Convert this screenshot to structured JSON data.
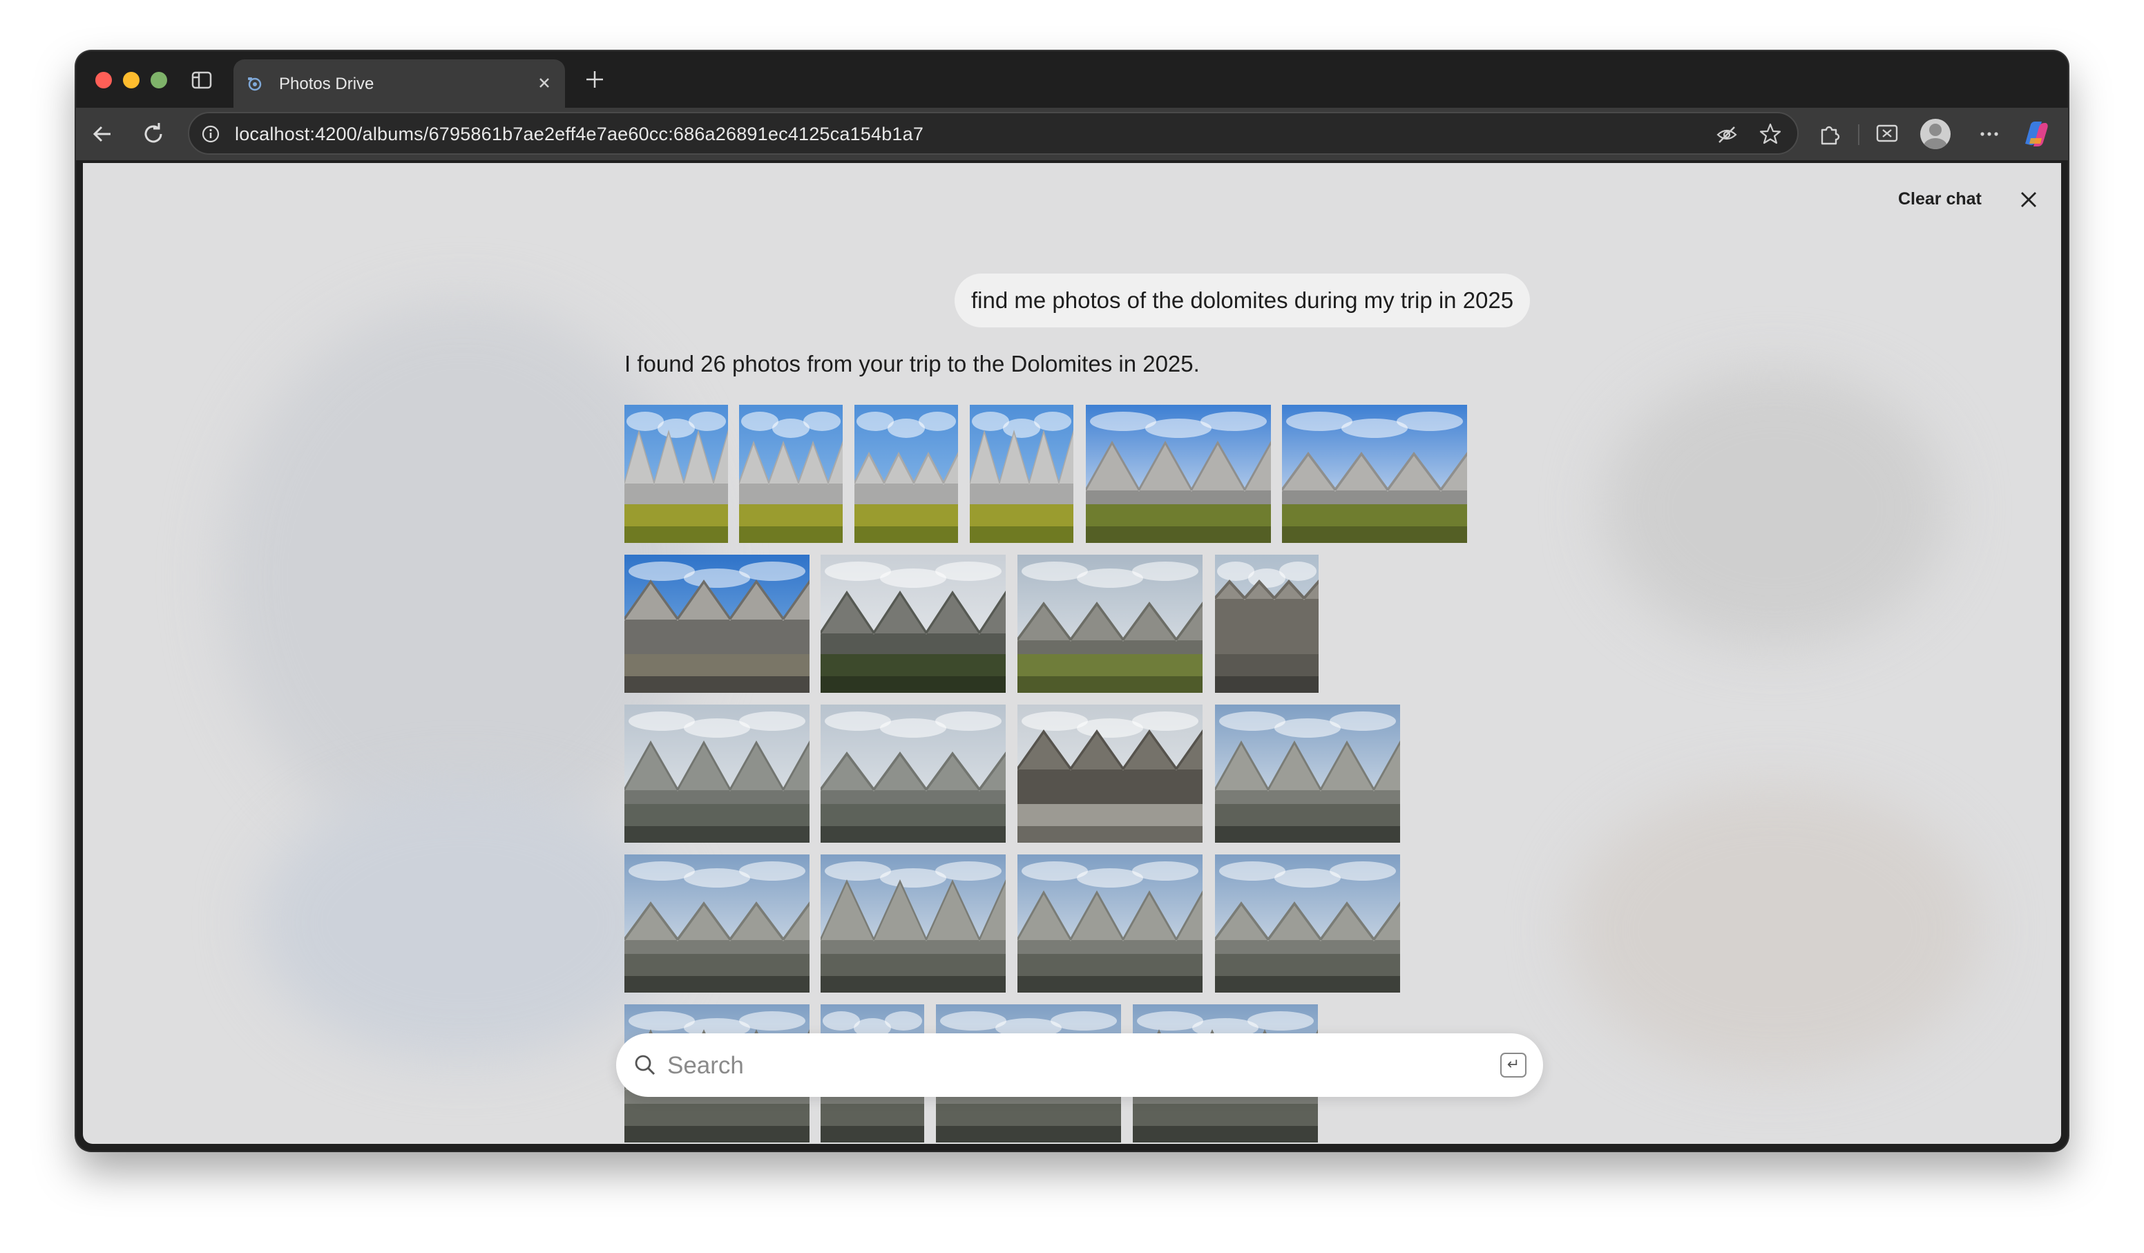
{
  "browser": {
    "tab_title": "Photos Drive",
    "url": "localhost:4200/albums/6795861b7ae2eff4e7ae60cc:686a26891ec4125ca154b1a7"
  },
  "chat": {
    "clear_label": "Clear chat",
    "user_message": "find me photos of the dolomites during my trip in 2025",
    "assistant_reply": "I found 26 photos from your trip to the Dolomites in 2025."
  },
  "search": {
    "placeholder": "Search",
    "enter_icon": "↵"
  },
  "photos": [
    {
      "scene": "meadow-peaks"
    },
    {
      "scene": "meadow-peaks"
    },
    {
      "scene": "meadow-peaks"
    },
    {
      "scene": "meadow-peaks"
    },
    {
      "scene": "village-peaks"
    },
    {
      "scene": "village-peaks"
    },
    {
      "scene": "sharp-peaks"
    },
    {
      "scene": "cloudy-peaks"
    },
    {
      "scene": "cloudy-valley"
    },
    {
      "scene": "tower"
    },
    {
      "scene": "grey-ridge"
    },
    {
      "scene": "grey-ridge"
    },
    {
      "scene": "three-peaks"
    },
    {
      "scene": "cloudy-ridge"
    },
    {
      "scene": "cloudy-ridge"
    },
    {
      "scene": "cloudy-ridge"
    },
    {
      "scene": "cloudy-ridge"
    },
    {
      "scene": "cloudy-ridge"
    },
    {
      "scene": "cloudy-ridge"
    },
    {
      "scene": "cloudy-ridge"
    },
    {
      "scene": "cloudy-ridge"
    },
    {
      "scene": "cloudy-ridge"
    }
  ]
}
